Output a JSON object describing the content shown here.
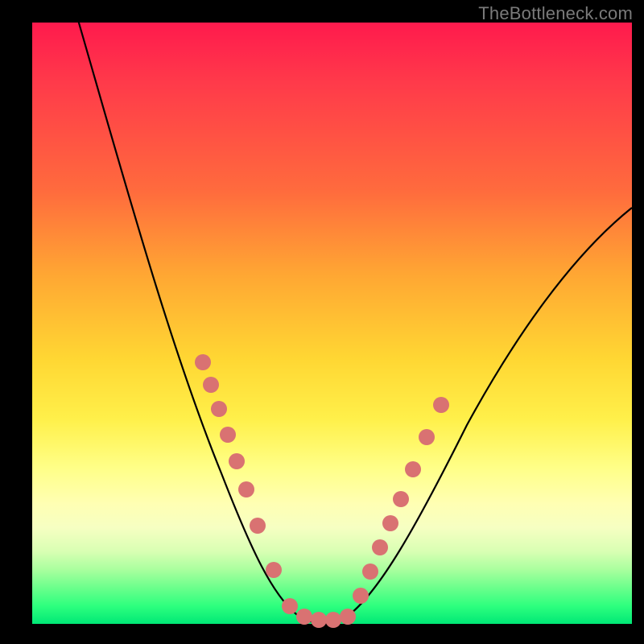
{
  "watermark": "TheBottleneck.com",
  "colors": {
    "dot": "#d97272",
    "curve": "#000000",
    "gradient_top": "#ff1a4d",
    "gradient_bottom": "#00e876"
  },
  "chart_data": {
    "type": "line",
    "title": "",
    "xlabel": "",
    "ylabel": "",
    "xlim": [
      0,
      100
    ],
    "ylim": [
      0,
      100
    ],
    "series": [
      {
        "name": "bottleneck-curve",
        "x": [
          10,
          14,
          18,
          22,
          26,
          29,
          32,
          34,
          36,
          38,
          40,
          42,
          44,
          46,
          48,
          50,
          52,
          55,
          58,
          62,
          66,
          70,
          75,
          80,
          86,
          92,
          98
        ],
        "y": [
          100,
          88,
          76,
          65,
          55,
          46,
          38,
          32,
          26,
          20,
          14,
          8,
          4,
          1,
          0,
          0,
          1,
          4,
          9,
          15,
          22,
          29,
          36,
          43,
          51,
          58,
          65
        ]
      }
    ],
    "markers": [
      {
        "name": "left-dots",
        "x": [
          29,
          30,
          31.5,
          33,
          34.5,
          36,
          38,
          41
        ],
        "y": [
          43,
          40,
          36,
          32,
          28,
          23,
          16,
          8
        ]
      },
      {
        "name": "right-dots",
        "x": [
          54,
          55.5,
          57,
          58.5,
          60,
          62,
          64.5,
          67
        ],
        "y": [
          8,
          12,
          16,
          20,
          24,
          29,
          34,
          39
        ]
      },
      {
        "name": "bottom-dots",
        "x": [
          43,
          45,
          47,
          49,
          51
        ],
        "y": [
          0.5,
          0.3,
          0.2,
          0.3,
          0.5
        ]
      }
    ]
  }
}
